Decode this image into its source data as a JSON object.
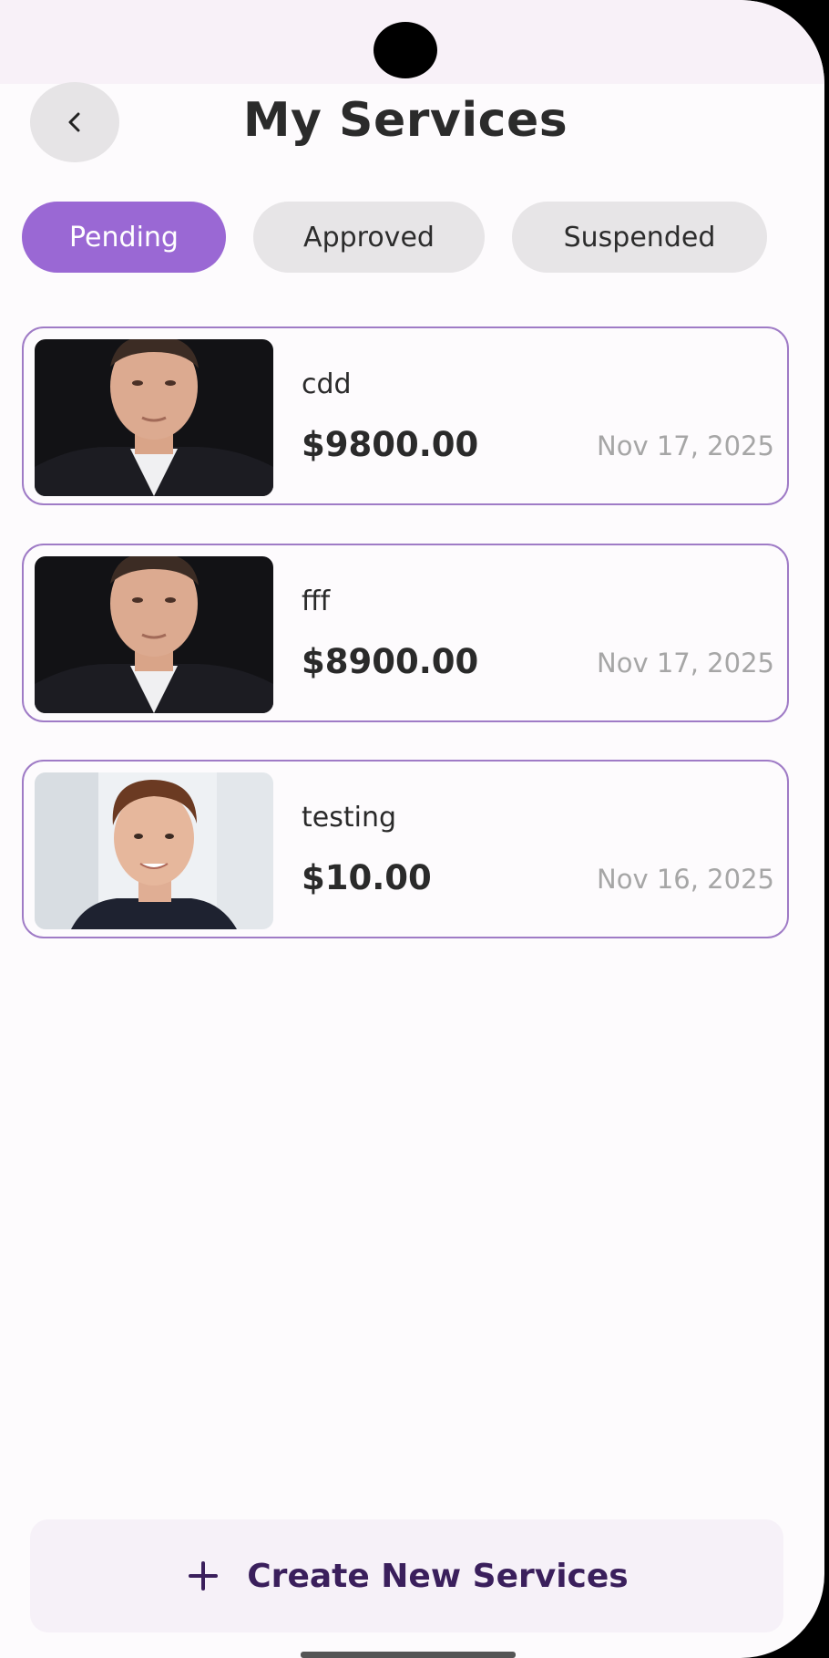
{
  "header": {
    "title": "My Services",
    "back_icon": "chevron-left-icon"
  },
  "tabs": [
    {
      "label": "Pending",
      "active": true
    },
    {
      "label": "Approved",
      "active": false
    },
    {
      "label": "Suspended",
      "active": false
    }
  ],
  "services": [
    {
      "name": "cdd",
      "price": "$9800.00",
      "date": "Nov 17, 2025",
      "thumbnail": "man-in-dark-suit-photo"
    },
    {
      "name": "fff",
      "price": "$8900.00",
      "date": "Nov 17, 2025",
      "thumbnail": "man-in-dark-suit-photo"
    },
    {
      "name": "testing",
      "price": "$10.00",
      "date": "Nov 16, 2025",
      "thumbnail": "smiling-man-photo"
    }
  ],
  "create_button": {
    "label": "Create New Services",
    "icon": "plus-icon"
  },
  "colors": {
    "accent": "#9a68d4",
    "card_border": "#9f7bc6",
    "create_text": "#3a1f5c"
  }
}
